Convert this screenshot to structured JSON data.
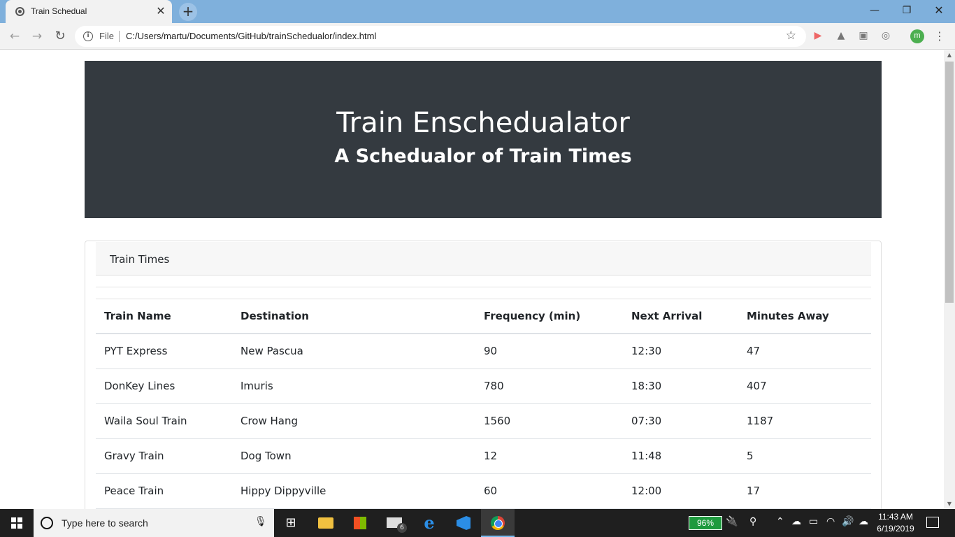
{
  "browser": {
    "tab_title": "Train Schedual",
    "url_scheme": "File",
    "url": "C:/Users/martu/Documents/GitHub/trainSchedualor/index.html",
    "profile_initial": "m"
  },
  "page": {
    "jumbotron": {
      "title": "Train Enschedualator",
      "subtitle": "A Schedualor of Train Times"
    },
    "card": {
      "header": "Train Times"
    },
    "table": {
      "headers": [
        "Train Name",
        "Destination",
        "Frequency (min)",
        "Next Arrival",
        "Minutes Away"
      ],
      "rows": [
        [
          "PYT Express",
          "New Pascua",
          "90",
          "12:30",
          "47"
        ],
        [
          "DonKey Lines",
          "Imuris",
          "780",
          "18:30",
          "407"
        ],
        [
          "Waila Soul Train",
          "Crow Hang",
          "1560",
          "07:30",
          "1187"
        ],
        [
          "Gravy Train",
          "Dog Town",
          "12",
          "11:48",
          "5"
        ],
        [
          "Peace Train",
          "Hippy Dippyville",
          "60",
          "12:00",
          "17"
        ]
      ]
    }
  },
  "taskbar": {
    "search_placeholder": "Type here to search",
    "mail_badge": "6",
    "battery": "96%",
    "time": "11:43 AM",
    "date": "6/19/2019"
  },
  "colors": {
    "titlebar": "#7fb0dc",
    "jumbotron_bg": "#343a40",
    "battery_green": "#1e9a3e"
  }
}
